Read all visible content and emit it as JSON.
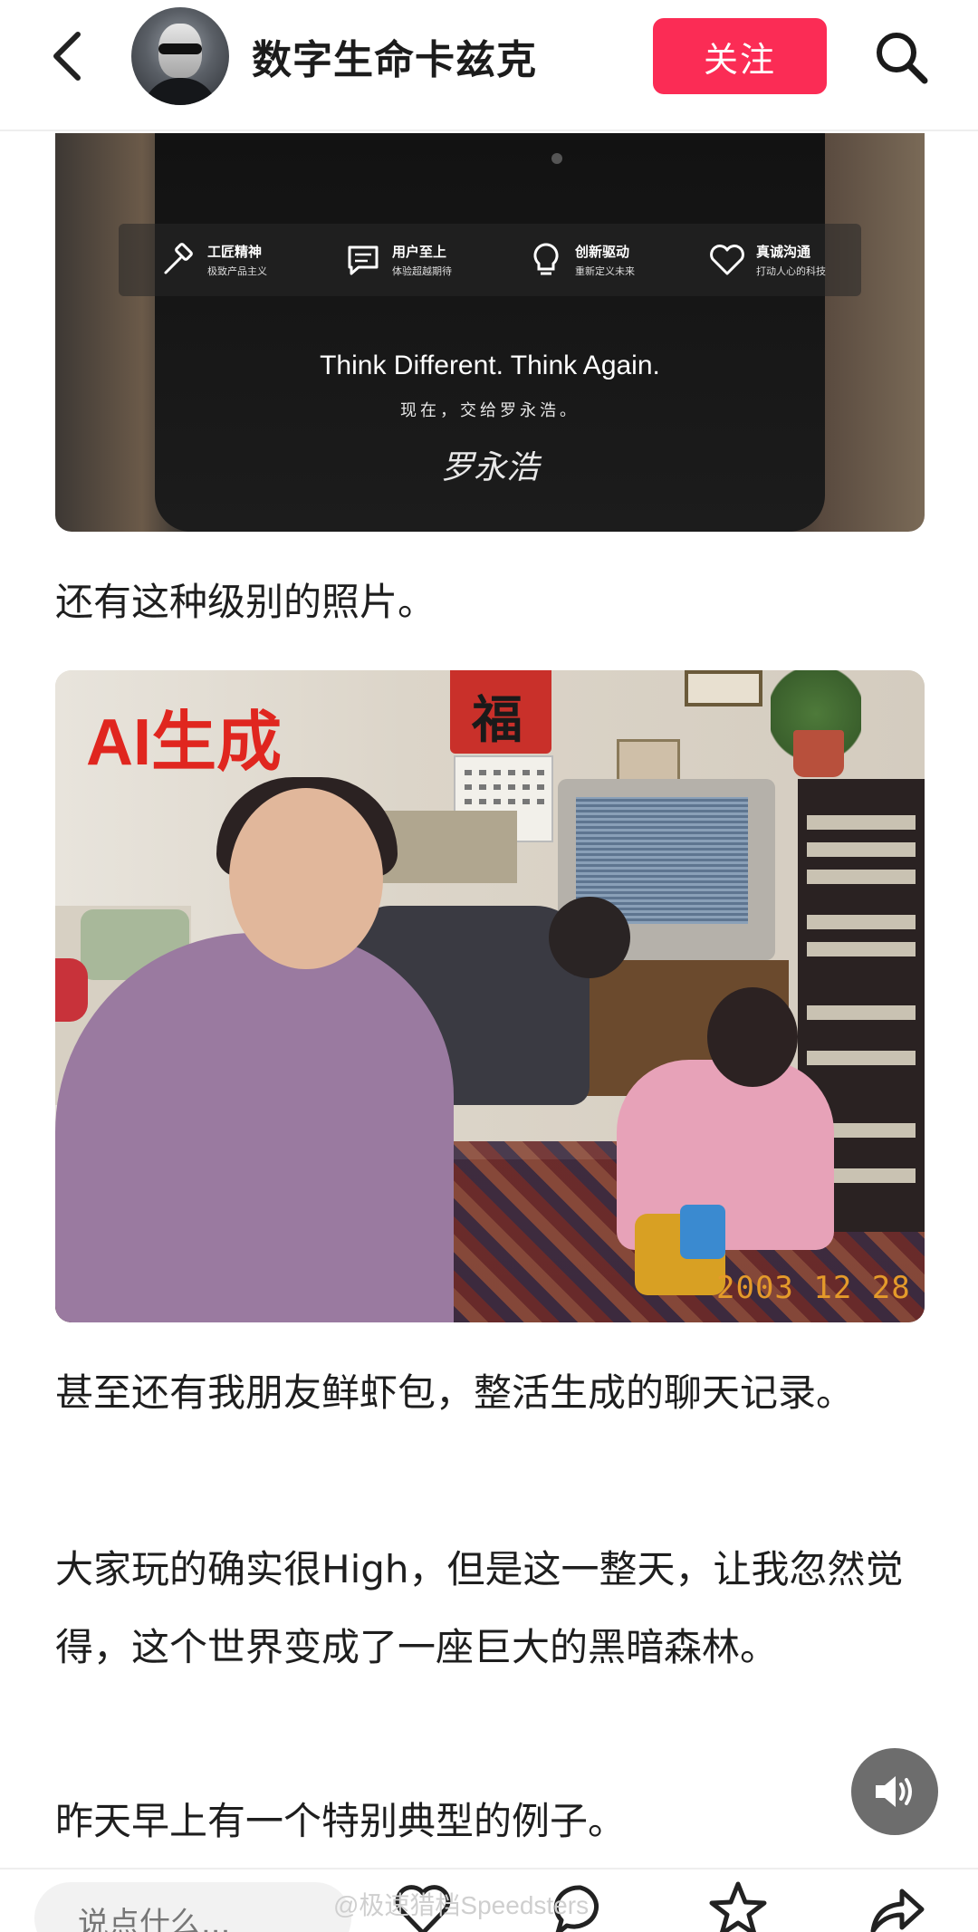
{
  "header": {
    "back_icon": "chevron-left-icon",
    "account_name": "数字生命卡兹克",
    "follow_label": "关注",
    "search_icon": "search-icon"
  },
  "image1": {
    "features": [
      {
        "icon": "hammer-icon",
        "title": "工匠精神",
        "subtitle": "极致产品主义"
      },
      {
        "icon": "chat-icon",
        "title": "用户至上",
        "subtitle": "体验超越期待"
      },
      {
        "icon": "lightbulb-icon",
        "title": "创新驱动",
        "subtitle": "重新定义未来"
      },
      {
        "icon": "heart-icon",
        "title": "真诚沟通",
        "subtitle": "打动人心的科技"
      }
    ],
    "slogan": "Think Different. Think Again.",
    "subline": "现在，交给罗永浩。",
    "signature": "罗永浩"
  },
  "paragraphs": {
    "p1": "还有这种级别的照片。",
    "p2": "甚至还有我朋友鲜虾包，整活生成的聊天记录。",
    "p3": "大家玩的确实很High，但是这一整天，让我忽然觉得，这个世界变成了一座巨大的黑暗森林。",
    "p4": "昨天早上有一个特别典型的例子。"
  },
  "image2": {
    "ai_label": "AI生成",
    "fu_char": "福",
    "date_stamp": "2003 12 28"
  },
  "bottom": {
    "comment_placeholder": "说点什么...",
    "icons": [
      "heart-icon",
      "comment-icon",
      "star-icon",
      "share-icon"
    ],
    "watermark": "@极速猎档Speedsters"
  },
  "colors": {
    "accent": "#fb2c55",
    "ai_label": "#e0261f"
  }
}
